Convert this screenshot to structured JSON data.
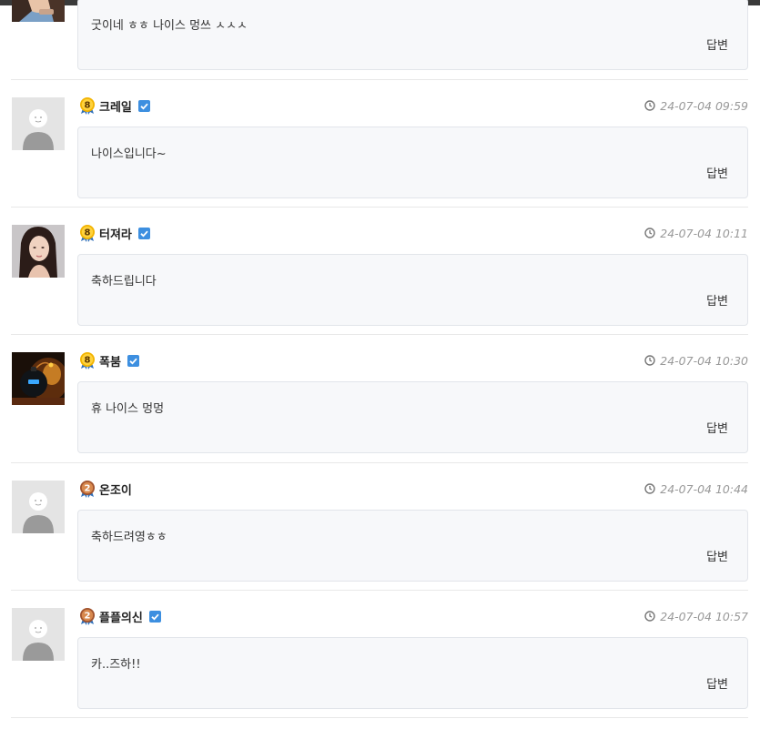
{
  "comments": [
    {
      "avatar": "photo-avatar",
      "level": "8",
      "name": "",
      "verified": false,
      "time": "",
      "text": "굿이네 ㅎㅎ  나이스 멍쓰 ㅅㅅㅅ",
      "reply_label": "답변"
    },
    {
      "avatar": "default-avatar",
      "level": "8",
      "name": "크레일",
      "verified": true,
      "time": "24-07-04 09:59",
      "text": "나이스입니다~",
      "reply_label": "답변"
    },
    {
      "avatar": "woman-photo-avatar",
      "level": "8",
      "name": "터져라",
      "verified": true,
      "time": "24-07-04 10:11",
      "text": "축하드립니다",
      "reply_label": "답변"
    },
    {
      "avatar": "bomb-photo-avatar",
      "level": "8",
      "name": "폭붐",
      "verified": true,
      "time": "24-07-04 10:30",
      "text": "휴 나이스 멍멍",
      "reply_label": "답변"
    },
    {
      "avatar": "default-avatar",
      "level": "2",
      "name": "온조이",
      "verified": false,
      "time": "24-07-04 10:44",
      "text": "축하드려영ㅎㅎ",
      "reply_label": "답변"
    },
    {
      "avatar": "default-avatar",
      "level": "2",
      "name": "플플의신",
      "verified": true,
      "time": "24-07-04 10:57",
      "text": "카..즈하!!",
      "reply_label": "답변"
    }
  ],
  "colors": {
    "verified": "#3d8fe0",
    "level8": "#f2b300",
    "level2": "#a0522d",
    "box_bg": "#f7f8fa",
    "box_border": "#e2e5ea"
  },
  "icons": {
    "time": "clock-icon",
    "verified": "verified-check-icon",
    "level": "level-badge-icon"
  }
}
